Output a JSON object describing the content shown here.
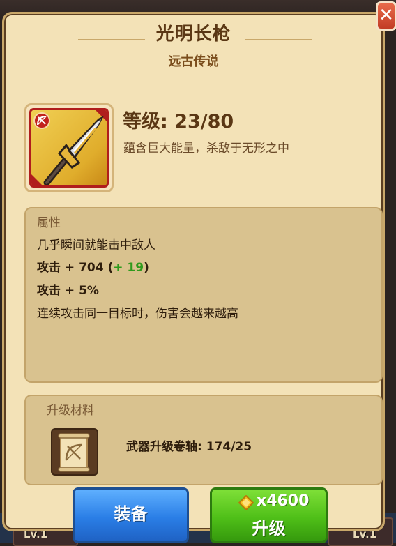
{
  "dialog": {
    "title": "光明长枪",
    "rarity": "远古传说",
    "close_label": "✕"
  },
  "item": {
    "icon": "spear-weapon-icon",
    "class_badge_icon": "bow-class-icon",
    "level_text": "等级: 23/80",
    "description": "蕴含巨大能量，杀敌于无形之中"
  },
  "attributes": {
    "header": "属性",
    "lines": [
      {
        "text": "几乎瞬间就能击中敌人"
      },
      {
        "text": "攻击 + 704 (",
        "bonus": "+ 19",
        "close": ")"
      },
      {
        "text": "攻击 + 5%"
      },
      {
        "text": "连续攻击同一目标时，伤害会越来越高"
      }
    ]
  },
  "materials": {
    "header": "升级材料",
    "icon": "bow-scroll-icon",
    "text": "武器升级卷轴: 174/25"
  },
  "buttons": {
    "equip_label": "装备",
    "upgrade_cost": "x4600",
    "upgrade_cost_icon": "gem-icon",
    "upgrade_label": "升级"
  },
  "background": {
    "slot_labels": [
      "Lv.1",
      "Lv.1"
    ]
  },
  "colors": {
    "panel": "#f3e2b7",
    "equip_button": "#2a7ee6",
    "upgrade_button": "#4fbf18",
    "close_button": "#c23d25",
    "bonus_text": "#2f9a1c"
  }
}
